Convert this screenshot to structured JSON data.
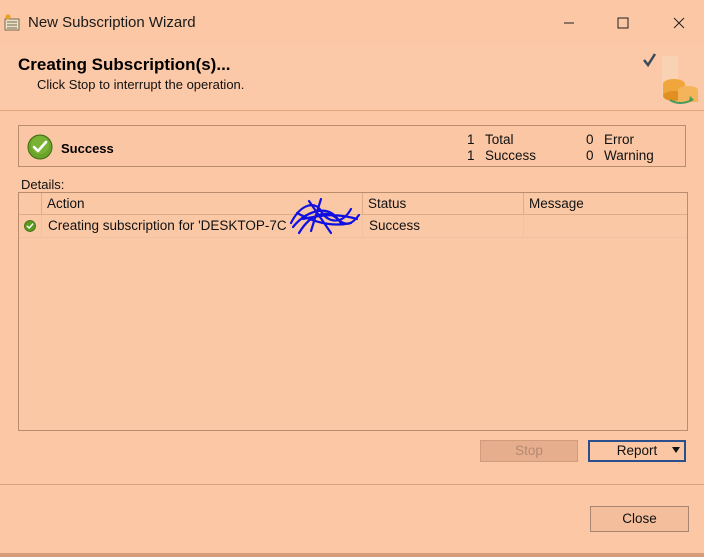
{
  "window": {
    "title": "New Subscription Wizard"
  },
  "header": {
    "title": "Creating Subscription(s)...",
    "subtitle": "Click Stop to interrupt the operation."
  },
  "summary": {
    "status": "Success",
    "total_count": "1",
    "total_label": "Total",
    "success_count": "1",
    "success_label": "Success",
    "error_count": "0",
    "error_label": "Error",
    "warning_count": "0",
    "warning_label": "Warning"
  },
  "details": {
    "label": "Details:",
    "columns": [
      "Action",
      "Status",
      "Message"
    ],
    "rows": [
      {
        "action": "Creating subscription for 'DESKTOP-7C",
        "status": "Success",
        "message": ""
      }
    ]
  },
  "buttons": {
    "stop": "Stop",
    "report": "Report",
    "close": "Close"
  },
  "colors": {
    "background": "#fbc7a4",
    "success_green": "#5b9a1f",
    "accent_blue": "#2b4f8c",
    "scribble_blue": "#1010e0"
  }
}
